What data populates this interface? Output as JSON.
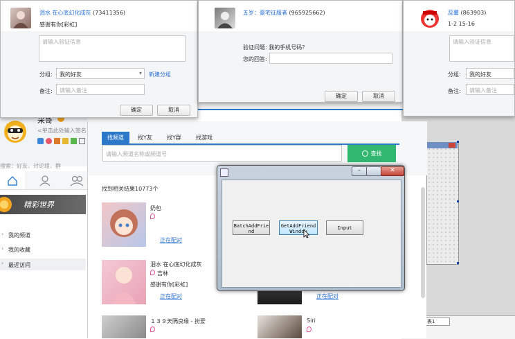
{
  "dialog1": {
    "name": "泪水 在心底幻化成灰",
    "qq": "(73411356)",
    "message": "感谢有你[彩虹]",
    "verify_placeholder": "请输入验证信息",
    "group_label": "分组:",
    "group_value": "我的好友",
    "new_group_link": "新建分组",
    "remark_label": "备注:",
    "remark_placeholder": "请输入备注",
    "ok": "确定",
    "cancel": "取消"
  },
  "dialog2": {
    "name": "五岁：豪宅征服者",
    "qq": "(965925662)",
    "question": "验证问题: 我的手机号码？",
    "answer_label": "您的回答:",
    "ok": "确定",
    "cancel": "取消"
  },
  "dialog3": {
    "name": "蕊馨",
    "qq": "(863903)",
    "sub": "1-2 15-16",
    "verify_placeholder": "请输入验证信息",
    "group_label": "分组:",
    "group_value": "我的好友",
    "remark_label": "备注:",
    "remark_placeholder": "请输入备注"
  },
  "qq_main": {
    "user_name": "采哥",
    "signature": "<单击此处输入签名",
    "search_placeholder": "搜索：好友、讨论组、群",
    "banner": "精彩世界",
    "nav": [
      "我的频道",
      "我的收藏",
      "最近访问"
    ]
  },
  "find": {
    "tabs": [
      "找频道",
      "找Y友",
      "找Y群",
      "找游戏"
    ],
    "search_placeholder": "请输入频道名称或频道号",
    "search_button": "查找",
    "result_count": "找到相关结果10773个",
    "results": [
      {
        "name": "奶包",
        "location": "",
        "desc": "",
        "link": "正在配对"
      },
      {
        "name": "泪水 在心底幻化成灰",
        "location": "吉林",
        "desc": "感谢有你[彩虹]",
        "link": "正在配对"
      },
      {
        "name": "１３９天隔良缘 - 扮爱",
        "location": "",
        "desc": "",
        "link": ""
      }
    ],
    "results_right": [
      {
        "name": "",
        "link": "正在配对"
      },
      {
        "name": "Siri",
        "link": ""
      }
    ]
  },
  "tool_window": {
    "buttons": [
      "BatchAddFriend",
      "GetAddFriendWindow",
      "Input"
    ]
  },
  "bg_strip": {
    "text": "表1"
  },
  "colors": {
    "accent_blue": "#2a6fd2",
    "search_green": "#31b76f",
    "bar_blue": "#2d78c8"
  }
}
